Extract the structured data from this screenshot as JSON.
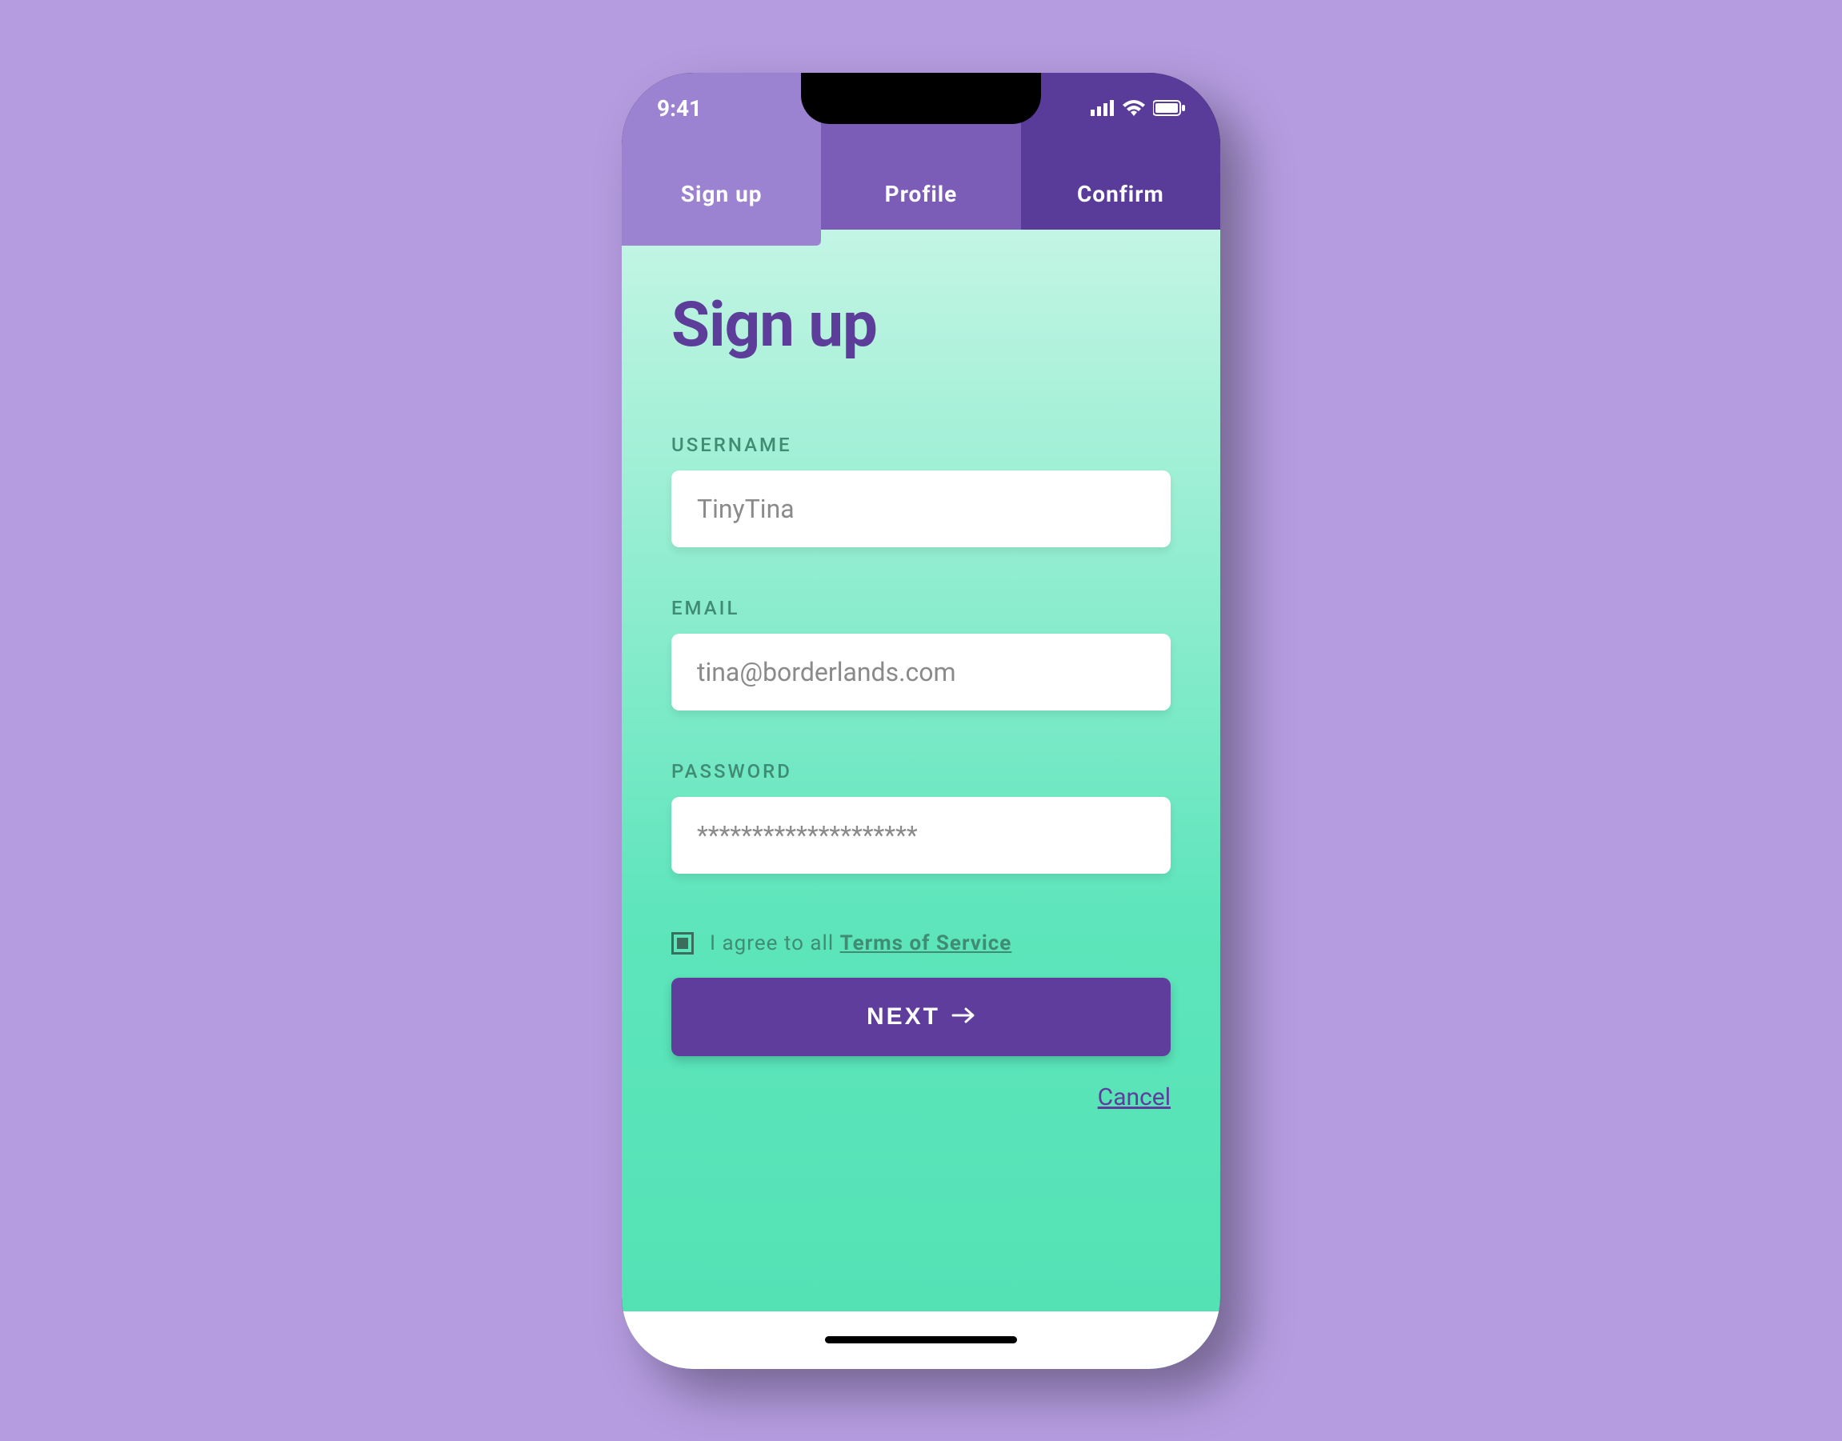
{
  "status": {
    "time": "9:41"
  },
  "tabs": {
    "signup": "Sign up",
    "profile": "Profile",
    "confirm": "Confirm"
  },
  "page": {
    "title": "Sign up"
  },
  "form": {
    "username": {
      "label": "USERNAME",
      "placeholder": "TinyTina"
    },
    "email": {
      "label": "EMAIL",
      "placeholder": "tina@borderlands.com"
    },
    "password": {
      "label": "PASSWORD",
      "placeholder": "********************"
    },
    "agree_text": "I agree to all ",
    "tos_link": "Terms of Service",
    "next": "NEXT",
    "cancel": "Cancel"
  },
  "colors": {
    "background": "#b59ce0",
    "tab_light": "#9b83d1",
    "tab_mid": "#7b5cb7",
    "tab_dark": "#593b99",
    "primary": "#5e3d9d",
    "teal_label": "#3f8c72"
  }
}
